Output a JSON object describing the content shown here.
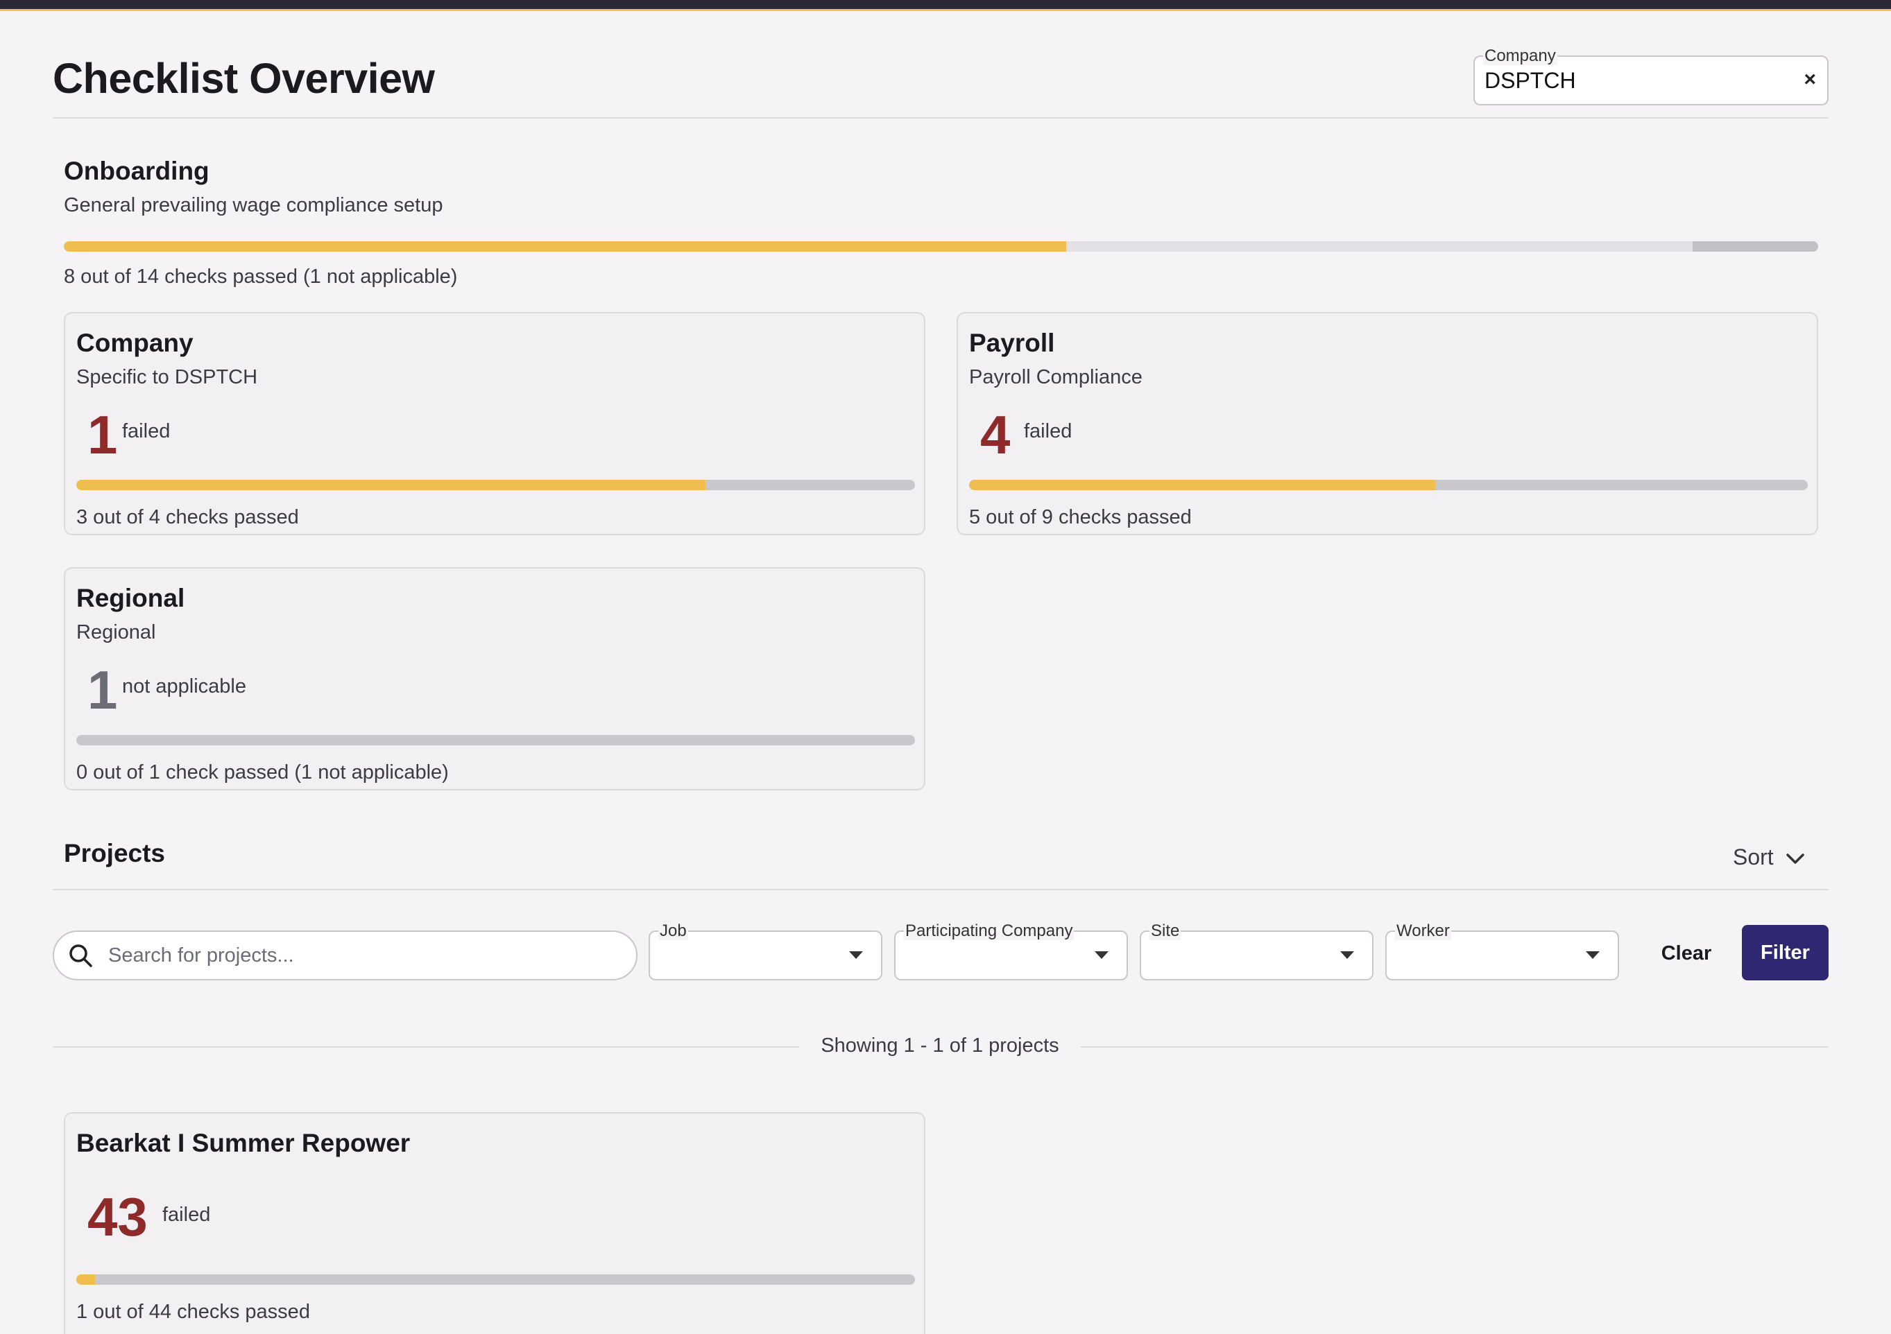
{
  "page": {
    "title": "Checklist Overview"
  },
  "company_filter": {
    "label": "Company",
    "value": "DSPTCH",
    "clear_label": "×"
  },
  "onboarding": {
    "title": "Onboarding",
    "subtitle": "General prevailing wage compliance setup",
    "progress": {
      "passed": 8,
      "total": 14,
      "not_applicable": 1
    },
    "progress_text": "8 out of 14 checks passed (1 not applicable)"
  },
  "categories": [
    {
      "title": "Company",
      "subtitle": "Specific to DSPTCH",
      "count": "1",
      "count_label": "failed",
      "progress": {
        "passed": 3,
        "total": 4
      },
      "progress_text": "3 out of 4 checks passed"
    },
    {
      "title": "Payroll",
      "subtitle": "Payroll Compliance",
      "count": "4",
      "count_label": "failed",
      "progress": {
        "passed": 5,
        "total": 9
      },
      "progress_text": "5 out of 9 checks passed"
    },
    {
      "title": "Regional",
      "subtitle": "Regional",
      "count": "1",
      "count_label": "not applicable",
      "progress": {
        "passed": 0,
        "total": 1,
        "not_applicable": 1
      },
      "progress_text": "0 out of 1 check passed (1 not applicable)"
    }
  ],
  "projects": {
    "title": "Projects",
    "sort_label": "Sort",
    "search": {
      "placeholder": "Search for projects...",
      "value": ""
    },
    "filters": [
      {
        "label": "Job",
        "value": ""
      },
      {
        "label": "Participating Company",
        "value": ""
      },
      {
        "label": "Site",
        "value": ""
      },
      {
        "label": "Worker",
        "value": ""
      }
    ],
    "clear_label": "Clear",
    "filter_label": "Filter",
    "showing_text": "Showing 1 - 1 of 1 projects",
    "items": [
      {
        "title": "Bearkat I Summer Repower",
        "count": "43",
        "count_label": "failed",
        "progress": {
          "passed": 1,
          "total": 44
        },
        "progress_text": "1 out of 44 checks passed"
      }
    ]
  },
  "colors": {
    "accent": "#f0bd4f",
    "failed": "#8e2a2a",
    "primary_button": "#2e2872",
    "not_applicable": "#6c6c76"
  }
}
